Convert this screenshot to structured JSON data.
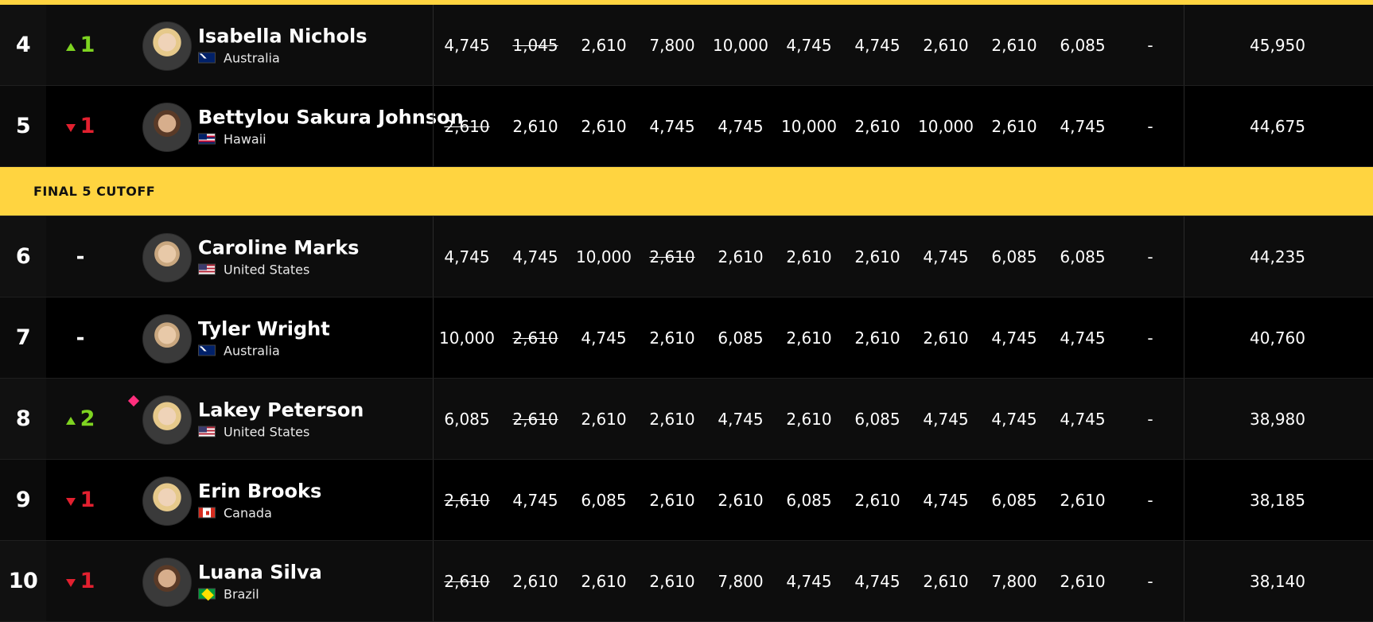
{
  "cutoff_label": "FINAL 5 CUTOFF",
  "rows_top": [
    {
      "rank": "4",
      "move": {
        "dir": "up",
        "num": "1"
      },
      "name": "Isabella Nichols",
      "country": "Australia",
      "flag": "au",
      "avatar": "blond",
      "scores": [
        {
          "v": "4,745"
        },
        {
          "v": "1,045",
          "s": true
        },
        {
          "v": "2,610"
        },
        {
          "v": "7,800"
        },
        {
          "v": "10,000"
        },
        {
          "v": "4,745"
        },
        {
          "v": "4,745"
        },
        {
          "v": "2,610"
        },
        {
          "v": "2,610"
        },
        {
          "v": "6,085"
        },
        {
          "v": "-"
        }
      ],
      "total": "45,950",
      "shade": "alt"
    },
    {
      "rank": "5",
      "move": {
        "dir": "down",
        "num": "1"
      },
      "name": "Bettylou Sakura Johnson",
      "country": "Hawaii",
      "flag": "hi",
      "avatar": "dark-hair",
      "scores": [
        {
          "v": "2,610",
          "s": true
        },
        {
          "v": "2,610"
        },
        {
          "v": "2,610"
        },
        {
          "v": "4,745"
        },
        {
          "v": "4,745"
        },
        {
          "v": "10,000"
        },
        {
          "v": "2,610"
        },
        {
          "v": "10,000"
        },
        {
          "v": "2,610"
        },
        {
          "v": "4,745"
        },
        {
          "v": "-"
        }
      ],
      "total": "44,675",
      "shade": "dark"
    }
  ],
  "rows_bottom": [
    {
      "rank": "6",
      "move": {
        "dir": "none",
        "num": "-"
      },
      "name": "Caroline Marks",
      "country": "United States",
      "flag": "us",
      "avatar": "",
      "scores": [
        {
          "v": "4,745"
        },
        {
          "v": "4,745"
        },
        {
          "v": "10,000"
        },
        {
          "v": "2,610",
          "s": true
        },
        {
          "v": "2,610"
        },
        {
          "v": "2,610"
        },
        {
          "v": "2,610"
        },
        {
          "v": "4,745"
        },
        {
          "v": "6,085"
        },
        {
          "v": "6,085"
        },
        {
          "v": "-"
        }
      ],
      "total": "44,235",
      "shade": "alt"
    },
    {
      "rank": "7",
      "move": {
        "dir": "none",
        "num": "-"
      },
      "name": "Tyler Wright",
      "country": "Australia",
      "flag": "au",
      "avatar": "",
      "scores": [
        {
          "v": "10,000"
        },
        {
          "v": "2,610",
          "s": true
        },
        {
          "v": "4,745"
        },
        {
          "v": "2,610"
        },
        {
          "v": "6,085"
        },
        {
          "v": "2,610"
        },
        {
          "v": "2,610"
        },
        {
          "v": "2,610"
        },
        {
          "v": "4,745"
        },
        {
          "v": "4,745"
        },
        {
          "v": "-"
        }
      ],
      "total": "40,760",
      "shade": "dark"
    },
    {
      "rank": "8",
      "move": {
        "dir": "up",
        "num": "2"
      },
      "name": "Lakey Peterson",
      "country": "United States",
      "flag": "us",
      "avatar": "blond",
      "diamond": true,
      "scores": [
        {
          "v": "6,085"
        },
        {
          "v": "2,610",
          "s": true
        },
        {
          "v": "2,610"
        },
        {
          "v": "2,610"
        },
        {
          "v": "4,745"
        },
        {
          "v": "2,610"
        },
        {
          "v": "6,085"
        },
        {
          "v": "4,745"
        },
        {
          "v": "4,745"
        },
        {
          "v": "4,745"
        },
        {
          "v": "-"
        }
      ],
      "total": "38,980",
      "shade": "alt"
    },
    {
      "rank": "9",
      "move": {
        "dir": "down",
        "num": "1"
      },
      "name": "Erin Brooks",
      "country": "Canada",
      "flag": "ca",
      "avatar": "blond",
      "scores": [
        {
          "v": "2,610",
          "s": true
        },
        {
          "v": "4,745"
        },
        {
          "v": "6,085"
        },
        {
          "v": "2,610"
        },
        {
          "v": "2,610"
        },
        {
          "v": "6,085"
        },
        {
          "v": "2,610"
        },
        {
          "v": "4,745"
        },
        {
          "v": "6,085"
        },
        {
          "v": "2,610"
        },
        {
          "v": "-"
        }
      ],
      "total": "38,185",
      "shade": "dark"
    },
    {
      "rank": "10",
      "move": {
        "dir": "down",
        "num": "1"
      },
      "name": "Luana Silva",
      "country": "Brazil",
      "flag": "br",
      "avatar": "dark-hair",
      "scores": [
        {
          "v": "2,610",
          "s": true
        },
        {
          "v": "2,610"
        },
        {
          "v": "2,610"
        },
        {
          "v": "2,610"
        },
        {
          "v": "7,800"
        },
        {
          "v": "4,745"
        },
        {
          "v": "4,745"
        },
        {
          "v": "2,610"
        },
        {
          "v": "7,800"
        },
        {
          "v": "2,610"
        },
        {
          "v": "-"
        }
      ],
      "total": "38,140",
      "shade": "alt"
    }
  ]
}
